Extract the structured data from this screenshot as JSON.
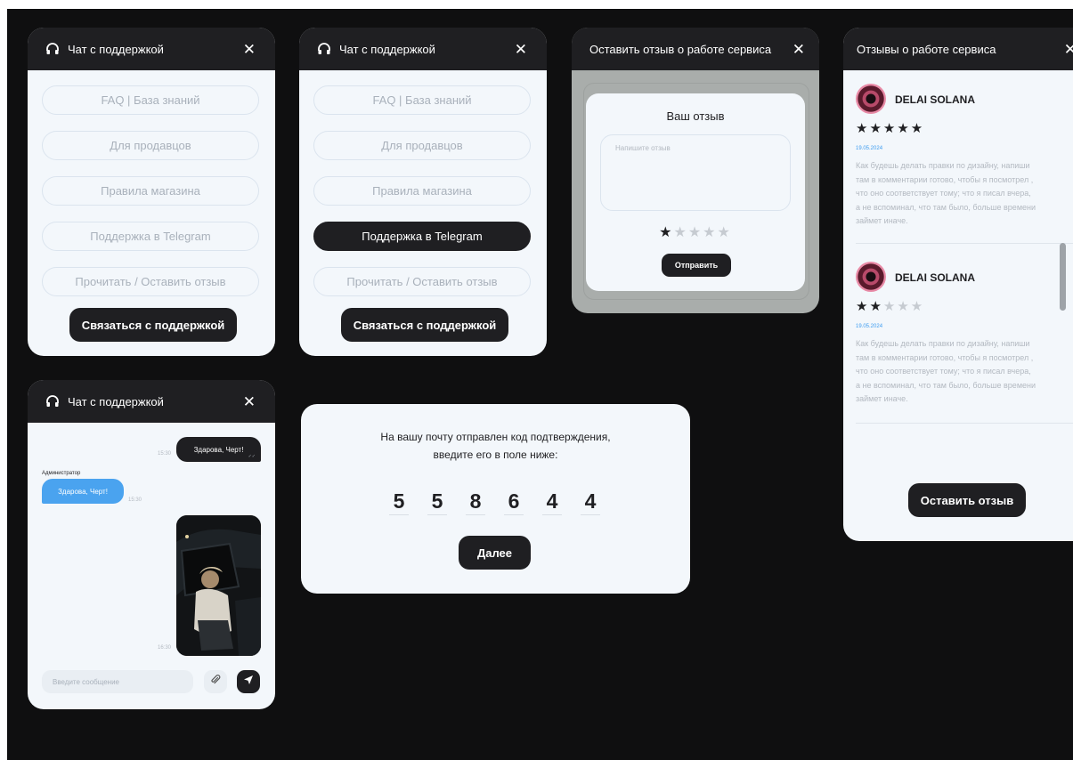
{
  "support_panel_1": {
    "title": "Чат с поддержкой",
    "close": "✕",
    "items": [
      "FAQ | База знаний",
      "Для продавцов",
      "Правила магазина",
      "Поддержка в Telegram",
      "Прочитать / Оставить отзыв"
    ],
    "contact_button": "Связаться с поддержкой"
  },
  "support_panel_2": {
    "title": "Чат с поддержкой",
    "close": "✕",
    "items": [
      "FAQ | База знаний",
      "Для продавцов",
      "Правила магазина",
      "Поддержка в Telegram",
      "Прочитать / Оставить отзыв"
    ],
    "active_item": "Поддержка в Telegram",
    "contact_button": "Связаться с поддержкой"
  },
  "review_modal": {
    "title": "Оставить отзыв о работе сервиса",
    "close": "✕",
    "heading": "Ваш отзыв",
    "placeholder": "Напишите отзыв",
    "rating": 1,
    "stars_max": 5,
    "filled_star": "★",
    "empty_star": "★★★★",
    "submit": "Отправить"
  },
  "reviews_panel": {
    "title": "Отзывы о работе сервиса",
    "close": "✕",
    "reviews": [
      {
        "author": "DELAI SOLANA",
        "stars_filled": "★★★★★",
        "stars_empty": "",
        "rating": 5,
        "date": "19.05.2024",
        "lines": [
          "Как будешь делать правки по дизайну, напиши",
          "там в комментарии готово, чтобы я посмотрел ,",
          "что оно соответствует тому; что я писал вчера,",
          "а не вспоминал, что там было, больше времени",
          "займет иначе."
        ]
      },
      {
        "author": "DELAI SOLANA",
        "stars_filled": "★★",
        "stars_empty": "★★★",
        "rating": 2,
        "date": "19.05.2024",
        "lines": [
          "Как будешь делать правки по дизайну, напиши",
          "там в комментарии готово, чтобы я посмотрел ,",
          "что оно соответствует тому; что я писал вчера,",
          "а не вспоминал, что там было, больше времени",
          "займет иначе."
        ]
      }
    ],
    "leave_review_button": "Оставить отзыв"
  },
  "chat_panel": {
    "title": "Чат с поддержкой",
    "close": "✕",
    "messages": [
      {
        "from": "user",
        "text": "Здарова, Черт!",
        "time": "15:30",
        "check": "✓✓"
      },
      {
        "from": "admin",
        "sender": "Администратор",
        "text": "Здарова, Черт!",
        "time": "15:30"
      },
      {
        "from": "user",
        "type": "image",
        "time": "16:30"
      }
    ],
    "input_placeholder": "Введите сообщение"
  },
  "verify_dialog": {
    "line1": "На вашу почту отправлен код подтверждения,",
    "line2": "введите его в поле ниже:",
    "code": [
      "5",
      "5",
      "8",
      "6",
      "4",
      "4"
    ],
    "next_button": "Далее"
  },
  "colors": {
    "background": "#0f0f10",
    "panel": "#f3f7fb",
    "header": "#1f1f22",
    "accent_blue": "#4aa3ef",
    "muted_text": "#a9b1bb"
  }
}
